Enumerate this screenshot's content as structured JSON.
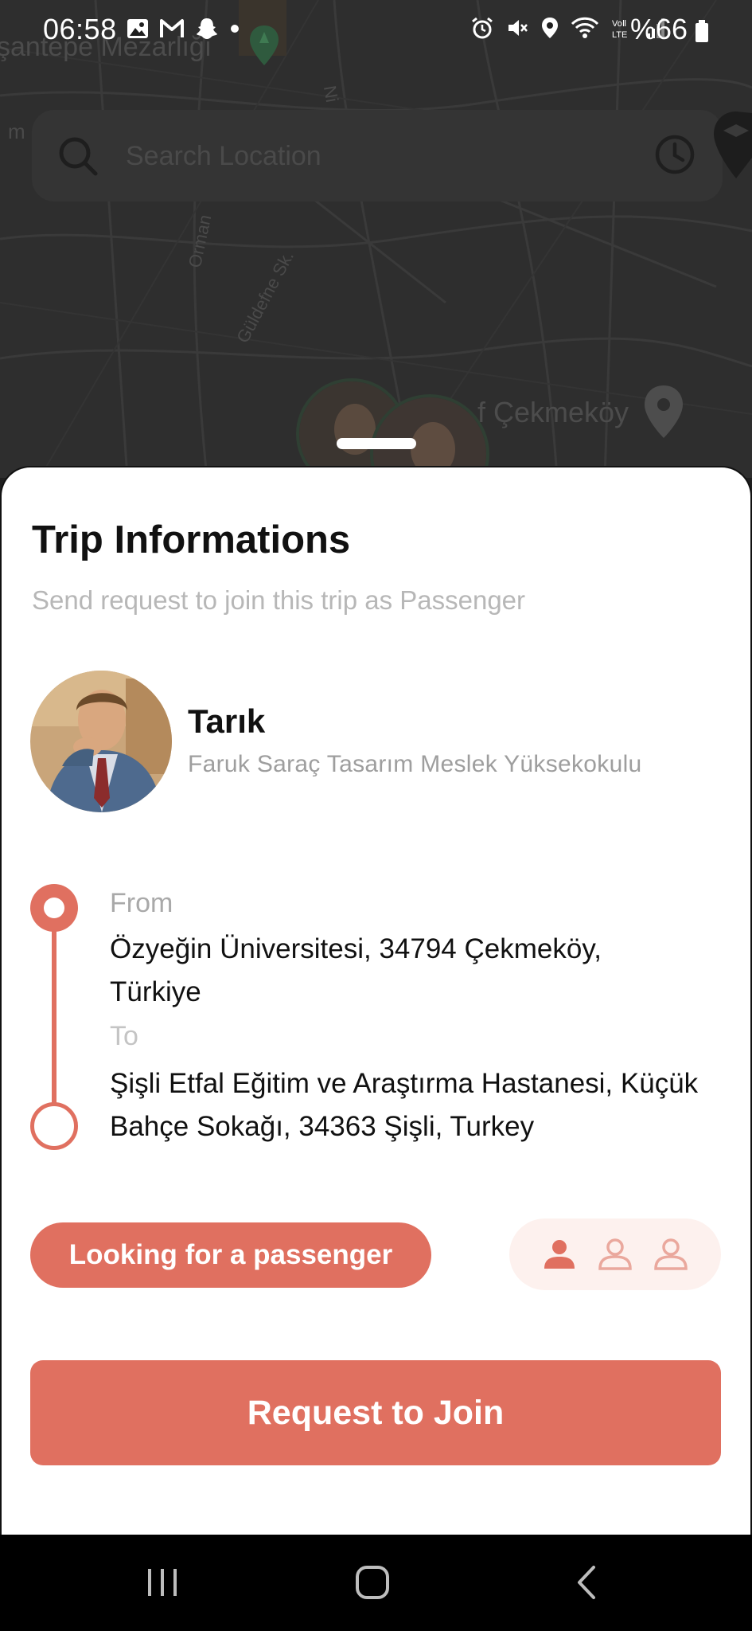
{
  "status_bar": {
    "time": "06:58",
    "battery": "%66",
    "left_icons": [
      "gallery-icon",
      "gmail-icon",
      "snapchat-icon",
      "dot-icon"
    ],
    "right_icons": [
      "alarm-icon",
      "mute-icon",
      "location-icon",
      "wifi-icon",
      "volte-icon",
      "signal-icon"
    ]
  },
  "map": {
    "labels": {
      "mezarligi": "şantepe Mezarlığı",
      "n": "Ni",
      "m": "m",
      "orman": "Orman",
      "guldefne": "Güldefne Sk.",
      "cekmekoy": "f Çekmeköy"
    }
  },
  "search": {
    "placeholder": "Search Location"
  },
  "trip": {
    "title": "Trip Informations",
    "subtitle": "Send request to join this trip as Passenger",
    "driver": {
      "name": "Tarık",
      "school": "Faruk Saraç Tasarım Meslek Yüksekokulu"
    },
    "from_label": "From",
    "from_address": "Özyeğin Üniversitesi, 34794 Çekmeköy, Türkiye",
    "to_label": "To",
    "to_address": "Şişli Etfal Eğitim ve Araştırma Hastanesi, Küçük Bahçe Sokağı, 34363 Şişli, Turkey",
    "status": "Looking for a passenger",
    "seats": {
      "filled": 1,
      "total": 3
    },
    "join_label": "Request to Join"
  },
  "colors": {
    "accent": "#e07060",
    "accent_light": "#fdf1ee",
    "map_bg": "#2e2e2e"
  }
}
